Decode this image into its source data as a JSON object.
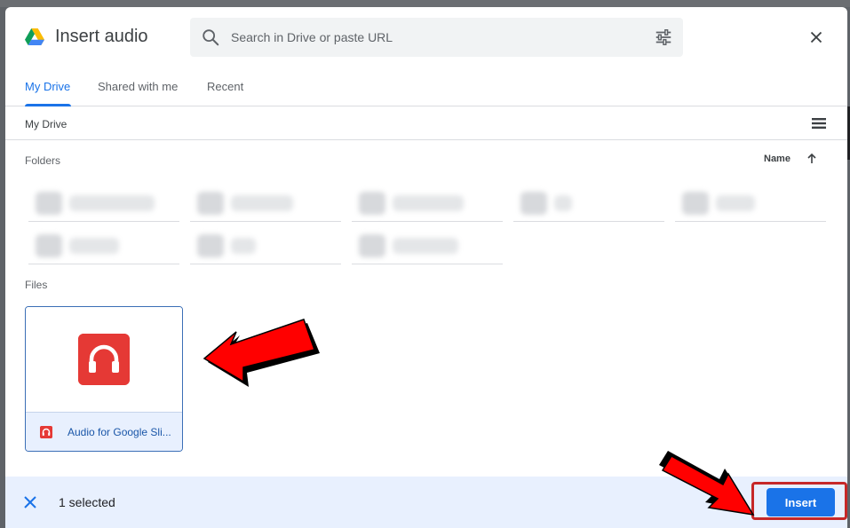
{
  "dialog": {
    "title": "Insert audio",
    "close_icon": "close-icon"
  },
  "search": {
    "placeholder": "Search in Drive or paste URL",
    "icon": "search-icon",
    "filter_icon": "tune-icon"
  },
  "tabs": [
    {
      "label": "My Drive",
      "active": true
    },
    {
      "label": "Shared with me",
      "active": false
    },
    {
      "label": "Recent",
      "active": false
    }
  ],
  "breadcrumb": "My Drive",
  "folders_section": {
    "label": "Folders",
    "sort_label": "Name",
    "sort_direction": "ascending"
  },
  "files_section": {
    "label": "Files",
    "files": [
      {
        "name": "Audio for Google Sli...",
        "selected": true,
        "icon": "headphones-icon"
      }
    ]
  },
  "footer": {
    "selected_text": "1 selected",
    "insert_label": "Insert"
  },
  "colors": {
    "accent": "#1a73e8",
    "selection_bg": "#e8f0fe",
    "file_icon": "#e53935",
    "annotation": "#ff0000"
  }
}
